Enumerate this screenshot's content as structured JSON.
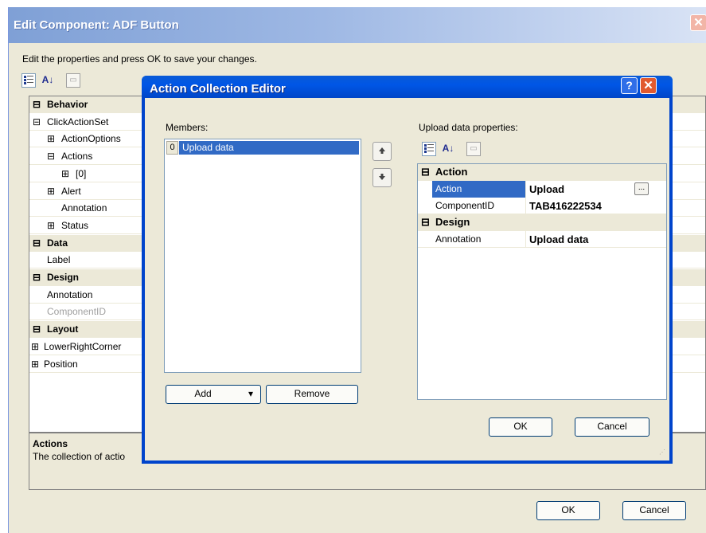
{
  "outer": {
    "title": "Edit Component: ADF Button",
    "close_glyph": "✕",
    "instruction": "Edit the properties and press OK to save your changes.",
    "toolbar": {
      "categorized_icon": "categorized-icon",
      "alpha_label": "A↓",
      "pages_icon": "property-pages-icon"
    },
    "grid_rows": [
      {
        "label": "Behavior",
        "type": "category",
        "expander": "⊟"
      },
      {
        "label": "ClickActionSet",
        "type": "item",
        "expander": "⊟",
        "indent": 0
      },
      {
        "label": "ActionOptions",
        "type": "item",
        "expander": "⊞",
        "indent": 1
      },
      {
        "label": "Actions",
        "type": "item",
        "expander": "⊟",
        "indent": 1
      },
      {
        "label": "[0]",
        "type": "item",
        "expander": "⊞",
        "indent": 2
      },
      {
        "label": "Alert",
        "type": "item",
        "expander": "⊞",
        "indent": 1
      },
      {
        "label": "Annotation",
        "type": "item",
        "expander": "",
        "indent": 1
      },
      {
        "label": "Status",
        "type": "item",
        "expander": "⊞",
        "indent": 1
      },
      {
        "label": "Data",
        "type": "category",
        "expander": "⊟"
      },
      {
        "label": "Label",
        "type": "item",
        "expander": "",
        "indent": 0
      },
      {
        "label": "Design",
        "type": "category",
        "expander": "⊟"
      },
      {
        "label": "Annotation",
        "type": "item",
        "expander": "",
        "indent": 0
      },
      {
        "label": "ComponentID",
        "type": "item",
        "expander": "",
        "indent": 0,
        "disabled": true
      },
      {
        "label": "Layout",
        "type": "category",
        "expander": "⊟"
      },
      {
        "label": "LowerRightCorner",
        "type": "item",
        "expander": "⊞",
        "indent": -1
      },
      {
        "label": "Position",
        "type": "item",
        "expander": "⊞",
        "indent": -1
      }
    ],
    "description": {
      "title": "Actions",
      "text": "The collection of actio"
    },
    "ok_label": "OK",
    "cancel_label": "Cancel"
  },
  "editor": {
    "title": "Action Collection Editor",
    "help_glyph": "?",
    "close_glyph": "✕",
    "members_label": "Members:",
    "members": [
      {
        "index": "0",
        "label": "Upload data",
        "selected": true
      }
    ],
    "move_up_glyph": "🡅",
    "move_down_glyph": "🡇",
    "add_label": "Add",
    "add_dropdown_glyph": "▾",
    "remove_label": "Remove",
    "properties_label": "Upload data properties:",
    "prop_toolbar": {
      "alpha_label": "A↓"
    },
    "properties": [
      {
        "type": "category",
        "label": "Action",
        "expander": "⊟"
      },
      {
        "type": "item",
        "name": "Action",
        "value": "Upload",
        "selected": true,
        "has_ellipsis": true
      },
      {
        "type": "item",
        "name": "ComponentID",
        "value": "TAB416222534"
      },
      {
        "type": "category",
        "label": "Design",
        "expander": "⊟"
      },
      {
        "type": "item",
        "name": "Annotation",
        "value": "Upload data"
      }
    ],
    "ellipsis_label": "...",
    "ok_label": "OK",
    "cancel_label": "Cancel"
  },
  "colors": {
    "titlebar_blue": "#0054e3",
    "selection": "#316ac5",
    "dialog_bg": "#ece9d8"
  }
}
